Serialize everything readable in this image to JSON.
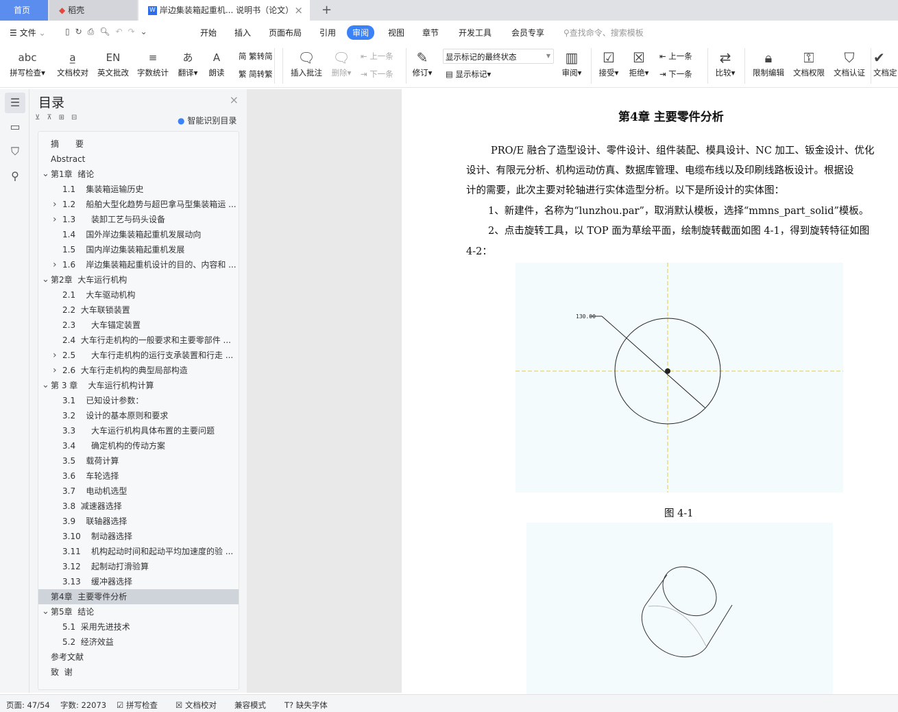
{
  "tabs": {
    "home": "首页",
    "daoke": "稻壳",
    "doc": "岸边集装箱起重机... 说明书（论文）",
    "add": "+",
    "close": "×"
  },
  "menu": {
    "file": "文件",
    "items": [
      "开始",
      "插入",
      "页面布局",
      "引用",
      "审阅",
      "视图",
      "章节",
      "开发工具",
      "会员专享"
    ],
    "active": "审阅",
    "search": "查找命令、搜索模板",
    "accent": "#3b82f6"
  },
  "ribbon": {
    "big": [
      {
        "label": "拼写检查▾",
        "icon": "abc"
      },
      {
        "label": "文档校对",
        "icon": "a̲"
      },
      {
        "label": "英文批改",
        "icon": "EN"
      },
      {
        "label": "字数统计",
        "icon": "≡"
      },
      {
        "label": "翻译▾",
        "icon": "あ"
      },
      {
        "label": "朗读",
        "icon": "A"
      }
    ],
    "convert": [
      "繁转简",
      "简转繁"
    ],
    "insert_comment": "插入批注",
    "delete": "删除▾",
    "prev": "上一条",
    "next": "下一条",
    "revise": "修订▾",
    "markup_state": "显示标记的最终状态",
    "show_markup": "显示标记▾",
    "review": "审阅▾",
    "accept": "接受▾",
    "reject": "拒绝▾",
    "prev2": "上一条",
    "next2": "下一条",
    "compare": "比较▾",
    "restrict": "限制编辑",
    "rights": "文档权限",
    "certify": "文档认证",
    "finalize": "文档定"
  },
  "toc": {
    "title": "目录",
    "smart": "智能识别目录",
    "close": "×",
    "items": [
      {
        "t": "摘　　要",
        "l": 0,
        "a": ""
      },
      {
        "t": "Abstract",
        "l": 0,
        "a": ""
      },
      {
        "t": "第1章  绪论",
        "l": 0,
        "a": "v"
      },
      {
        "t": "1.1    集装箱运输历史",
        "l": 1,
        "a": ""
      },
      {
        "t": "1.2    船舶大型化趋势与超巴拿马型集装箱运 ...",
        "l": 1,
        "a": ">"
      },
      {
        "t": "1.3      装卸工艺与码头设备",
        "l": 1,
        "a": ">"
      },
      {
        "t": "1.4    国外岸边集装箱起重机发展动向",
        "l": 1,
        "a": ""
      },
      {
        "t": "1.5    国内岸边集装箱起重机发展",
        "l": 1,
        "a": ""
      },
      {
        "t": "1.6    岸边集装箱起重机设计的目的、内容和 ...",
        "l": 1,
        "a": ">"
      },
      {
        "t": "第2章  大车运行机构",
        "l": 0,
        "a": "v"
      },
      {
        "t": "2.1    大车驱动机构",
        "l": 1,
        "a": ""
      },
      {
        "t": "2.2  大车联锁装置",
        "l": 1,
        "a": ""
      },
      {
        "t": "2.3      大车锚定装置",
        "l": 1,
        "a": ""
      },
      {
        "t": "2.4  大车行走机构的一般要求和主要零部件 ...",
        "l": 1,
        "a": ""
      },
      {
        "t": "2.5      大车行走机构的运行支承装置和行走 ...",
        "l": 1,
        "a": ">"
      },
      {
        "t": "2.6  大车行走机构的典型局部构造",
        "l": 1,
        "a": ">"
      },
      {
        "t": "第 3 章    大车运行机构计算",
        "l": 0,
        "a": "v"
      },
      {
        "t": "3.1    已知设计参数：",
        "l": 1,
        "a": ""
      },
      {
        "t": "3.2    设计的基本原则和要求",
        "l": 1,
        "a": ""
      },
      {
        "t": "3.3      大车运行机构具体布置的主要问题",
        "l": 1,
        "a": ""
      },
      {
        "t": "3.4      确定机构的传动方案",
        "l": 1,
        "a": ""
      },
      {
        "t": "3.5    载荷计算",
        "l": 1,
        "a": ""
      },
      {
        "t": "3.6    车轮选择",
        "l": 1,
        "a": ""
      },
      {
        "t": "3.7    电动机选型",
        "l": 1,
        "a": ""
      },
      {
        "t": "3.8  减速器选择",
        "l": 1,
        "a": ""
      },
      {
        "t": "3.9    联轴器选择",
        "l": 1,
        "a": ""
      },
      {
        "t": "3.10    制动器选择",
        "l": 1,
        "a": ""
      },
      {
        "t": "3.11    机构起动时间和起动平均加速度的验 ...",
        "l": 1,
        "a": ""
      },
      {
        "t": "3.12    起制动打滑验算",
        "l": 1,
        "a": ""
      },
      {
        "t": "3.13    缓冲器选择",
        "l": 1,
        "a": ""
      },
      {
        "t": "第4章  主要零件分析",
        "l": 0,
        "a": "",
        "sel": true
      },
      {
        "t": "第5章  结论",
        "l": 0,
        "a": "v"
      },
      {
        "t": "5.1  采用先进技术",
        "l": 1,
        "a": ""
      },
      {
        "t": "5.2  经济效益",
        "l": 1,
        "a": ""
      },
      {
        "t": "参考文献",
        "l": 0,
        "a": ""
      },
      {
        "t": "致  谢",
        "l": 0,
        "a": ""
      }
    ]
  },
  "doc": {
    "heading": "第4章  主要零件分析",
    "lines": [
      "PRO/E 融合了造型设计、零件设计、组件装配、模具设计、NC 加工、钣金设计、优化",
      "设计、有限元分析、机构运动仿真、数据库管理、电缆布线以及印刷线路板设计。根据设",
      "计的需要，此次主要对轮轴进行实体造型分析。以下是所设计的实体图：",
      "1、新建件，名称为“lunzhou.par”，取消默认模板，选择“mmns_part_solid”模板。",
      "2、点击旋转工具，以 TOP 面为草绘平面，绘制旋转截面如图 4-1，得到旋转特征如图",
      "4-2："
    ],
    "dimension": "130.00",
    "caption1": "图 4-1"
  },
  "status": {
    "page": "页面: 47/54",
    "words": "字数: 22073",
    "spell": "拼写检查",
    "proof": "文档校对",
    "compat": "兼容模式",
    "font": "缺失字体"
  }
}
